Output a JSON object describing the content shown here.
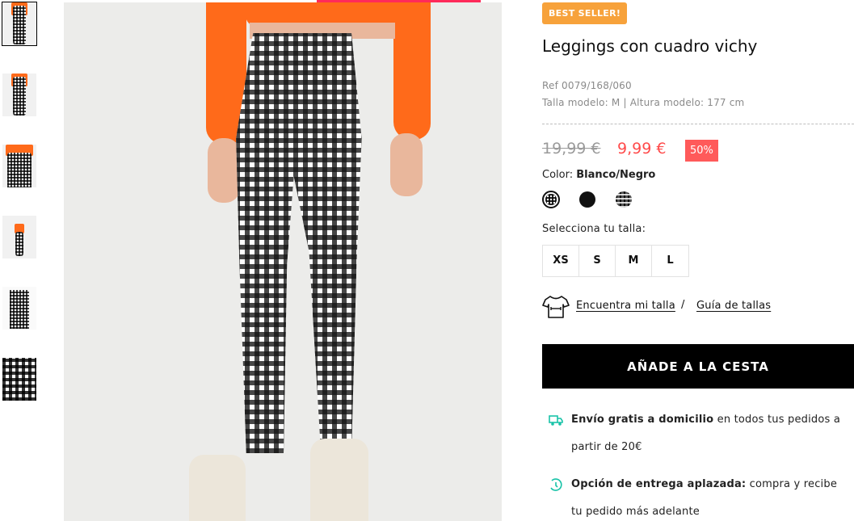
{
  "gallery": {
    "thumbnails": [
      {
        "name": "thumbnail-front-full",
        "active": true
      },
      {
        "name": "thumbnail-side",
        "active": false
      },
      {
        "name": "thumbnail-back",
        "active": false
      },
      {
        "name": "thumbnail-full-body",
        "active": false
      },
      {
        "name": "thumbnail-flat",
        "active": false
      },
      {
        "name": "thumbnail-fabric-detail",
        "active": false
      }
    ]
  },
  "product": {
    "badge": "BEST SELLER!",
    "title": "Leggings con cuadro vichy",
    "ref": "Ref 0079/168/060",
    "model_info": "Talla modelo: M | Altura modelo: 177 cm",
    "old_price": "19,99 €",
    "new_price": "9,99 €",
    "discount": "50%",
    "color_label": "Color:",
    "color_value": "Blanco/Negro",
    "colors": [
      "gingham-black-white",
      "black",
      "plaid-grey"
    ],
    "size_label": "Selecciona tu talla:",
    "sizes": [
      "XS",
      "S",
      "M",
      "L"
    ],
    "find_size": "Encuentra mi talla",
    "separator": "/",
    "size_guide": "Guía de tallas",
    "add_to_cart": "AÑADE A LA CESTA"
  },
  "info": {
    "shipping_bold": "Envío gratis a domicilio",
    "shipping_rest": "en todos tus pedidos a partir de 20€",
    "delivery_bold": "Opción de entrega aplazada:",
    "delivery_rest": "compra y recibe tu pedido más adelante"
  },
  "colors": {
    "badge": "#f7a23b",
    "sale": "#ff4b4b",
    "discount_bg": "#ff5a5a",
    "cta_bg": "#000000",
    "info_icon": "#19c3a8",
    "top_bar": "#ff2a5a"
  }
}
